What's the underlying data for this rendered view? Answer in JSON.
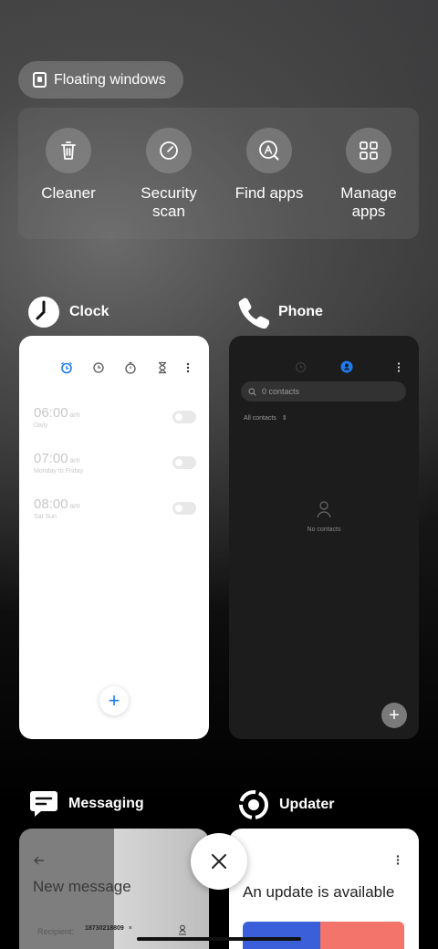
{
  "floating_windows": {
    "label": "Floating windows"
  },
  "quick_actions": [
    {
      "label_line1": "Cleaner",
      "label_line2": "",
      "icon": "trash-icon"
    },
    {
      "label_line1": "Security",
      "label_line2": "scan",
      "icon": "security-scan-icon"
    },
    {
      "label_line1": "Find apps",
      "label_line2": "",
      "icon": "find-apps-icon"
    },
    {
      "label_line1": "Manage",
      "label_line2": "apps",
      "icon": "grid-icon"
    }
  ],
  "recents": {
    "clock": {
      "name": "Clock",
      "alarms": [
        {
          "time": "06:00",
          "ampm": "am",
          "repeat": "Daily"
        },
        {
          "time": "07:00",
          "ampm": "am",
          "repeat": "Monday to Friday"
        },
        {
          "time": "08:00",
          "ampm": "am",
          "repeat": "Sat Sun"
        }
      ],
      "fab": "+"
    },
    "phone": {
      "name": "Phone",
      "search_placeholder": "0 contacts",
      "filter": "All contacts",
      "empty": "No contacts",
      "fab": "+"
    },
    "messaging": {
      "name": "Messaging",
      "title": "New message",
      "recipient_label": "Recipient:",
      "recipient_chip": "18730218809"
    },
    "updater": {
      "name": "Updater",
      "title": "An update is available"
    }
  },
  "colors": {
    "accent_blue": "#1e7bf0",
    "card_dark": "#1c1c1c"
  }
}
